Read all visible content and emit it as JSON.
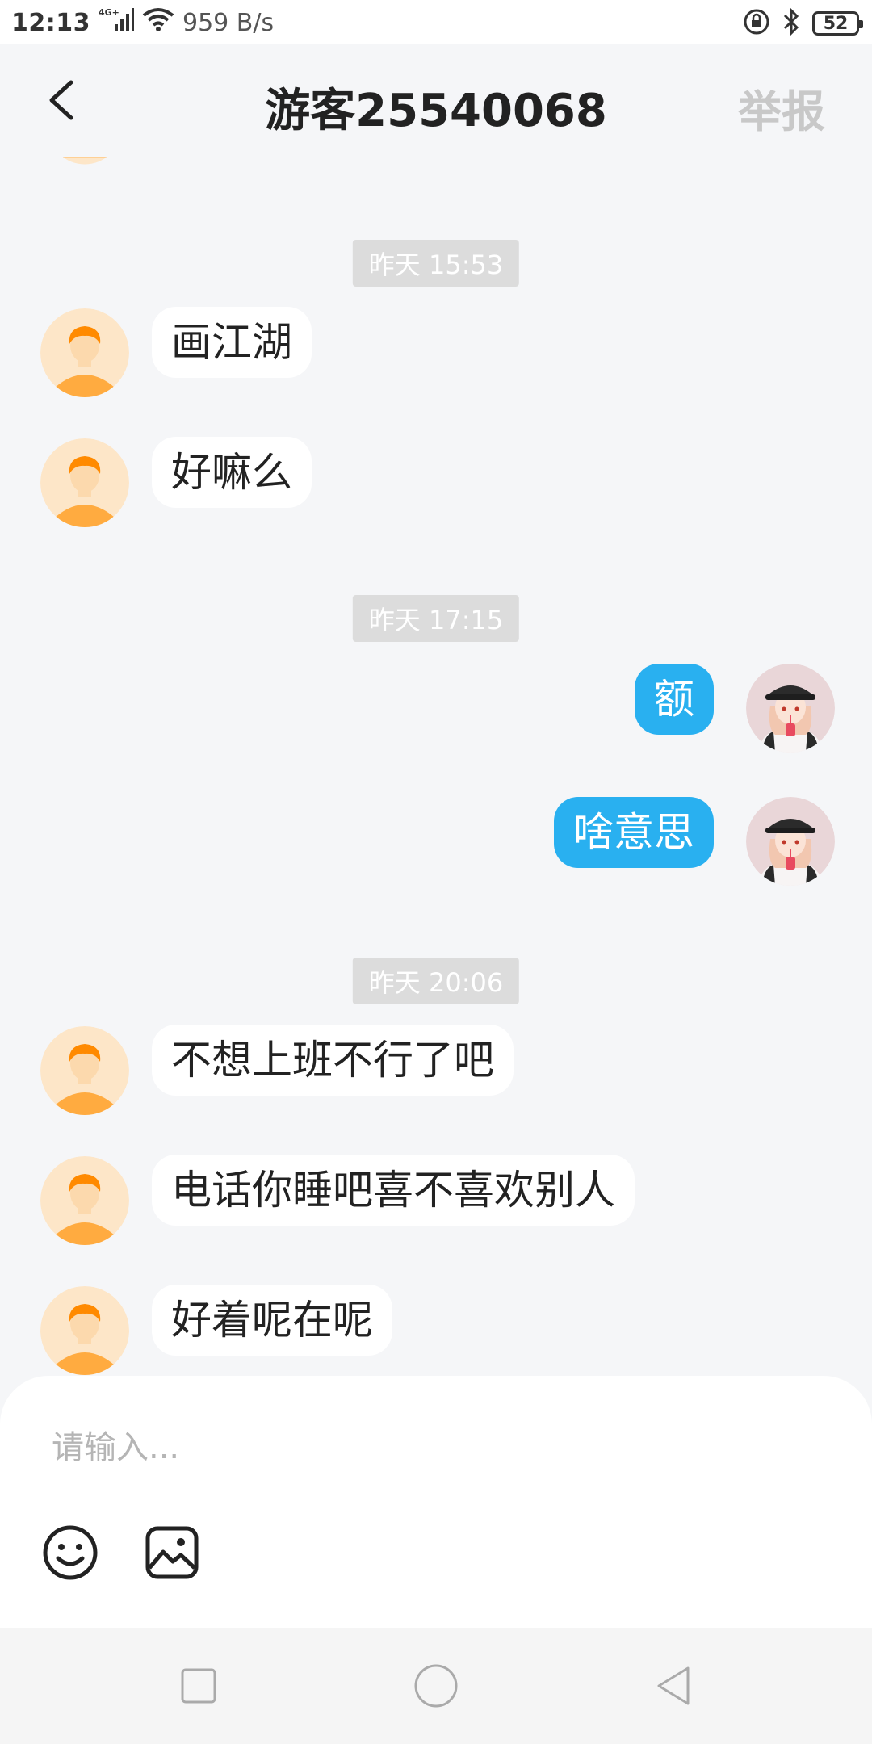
{
  "status_bar": {
    "time": "12:13",
    "network_type": "4G+",
    "net_speed": "959 B/s",
    "battery": "52",
    "icons": [
      "signal-icon",
      "wifi-icon",
      "lock-icon",
      "bluetooth-icon",
      "battery-icon"
    ]
  },
  "header": {
    "title": "游客25540068",
    "report_label": "举报"
  },
  "chat": {
    "timestamps": [
      "昨天 15:53",
      "昨天 17:15",
      "昨天 20:06"
    ],
    "messages": [
      {
        "side": "in",
        "text": "画江湖"
      },
      {
        "side": "in",
        "text": "好嘛么"
      },
      {
        "side": "out",
        "text": "额"
      },
      {
        "side": "out",
        "text": "啥意思"
      },
      {
        "side": "in",
        "text": "不想上班不行了吧"
      },
      {
        "side": "in",
        "text": "电话你睡吧喜不喜欢别人"
      },
      {
        "side": "in",
        "text": "好着呢在呢"
      }
    ]
  },
  "input": {
    "placeholder": "请输入...",
    "value": ""
  },
  "colors": {
    "outgoing_bubble": "#29b0f0",
    "incoming_bubble": "#ffffff",
    "background": "#f5f6f8",
    "report_text": "#c8c8c8",
    "guest_avatar_bg": "#fde6c8",
    "guest_avatar_accent": "#ff9a1f"
  }
}
